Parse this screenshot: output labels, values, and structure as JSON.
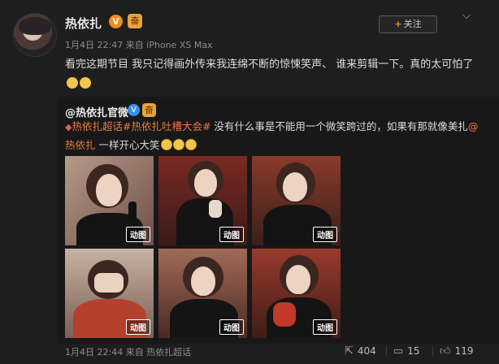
{
  "post": {
    "username": "热依扎",
    "vip_badge": "V",
    "level_badge": "奋",
    "meta": "1月4日 22:47 来自 iPhone XS Max",
    "follow_label": "关注",
    "follow_icon": "plus-icon",
    "menu_icon": "chevron-down-icon",
    "text": "看完这期节目 我只记得画外传来我连绵不断的惊悚笑声、 谁来剪辑一下。真的太可怕了"
  },
  "repost": {
    "username": "@热依扎官微",
    "verified_badge": "V",
    "level_badge": "奋",
    "topic1": "热依扎超话",
    "topic2": "#热依扎吐槽大会#",
    "text_plain": " 没有什么事是不能用一个微笑跨过的，如果有那就像美扎",
    "mention": "@热依扎",
    "text_tail": " 一样开心大笑",
    "gif_label": "动图",
    "photos": [
      "动图",
      "动图",
      "动图",
      "动图",
      "动图",
      "动图"
    ]
  },
  "footer": {
    "time": "1月4日 22:44 来自 热依扎超话",
    "share_icon": "share-icon",
    "share_count": "404",
    "comment_icon": "comment-icon",
    "comment_count": "15",
    "like_icon": "thumbs-up-icon",
    "like_count": "119"
  },
  "colors": {
    "background": "#1e1e1e",
    "repost_background": "#181818",
    "link": "#e87d3e",
    "vip_orange": "#f28a1a",
    "verified_blue": "#3a8ee6"
  }
}
